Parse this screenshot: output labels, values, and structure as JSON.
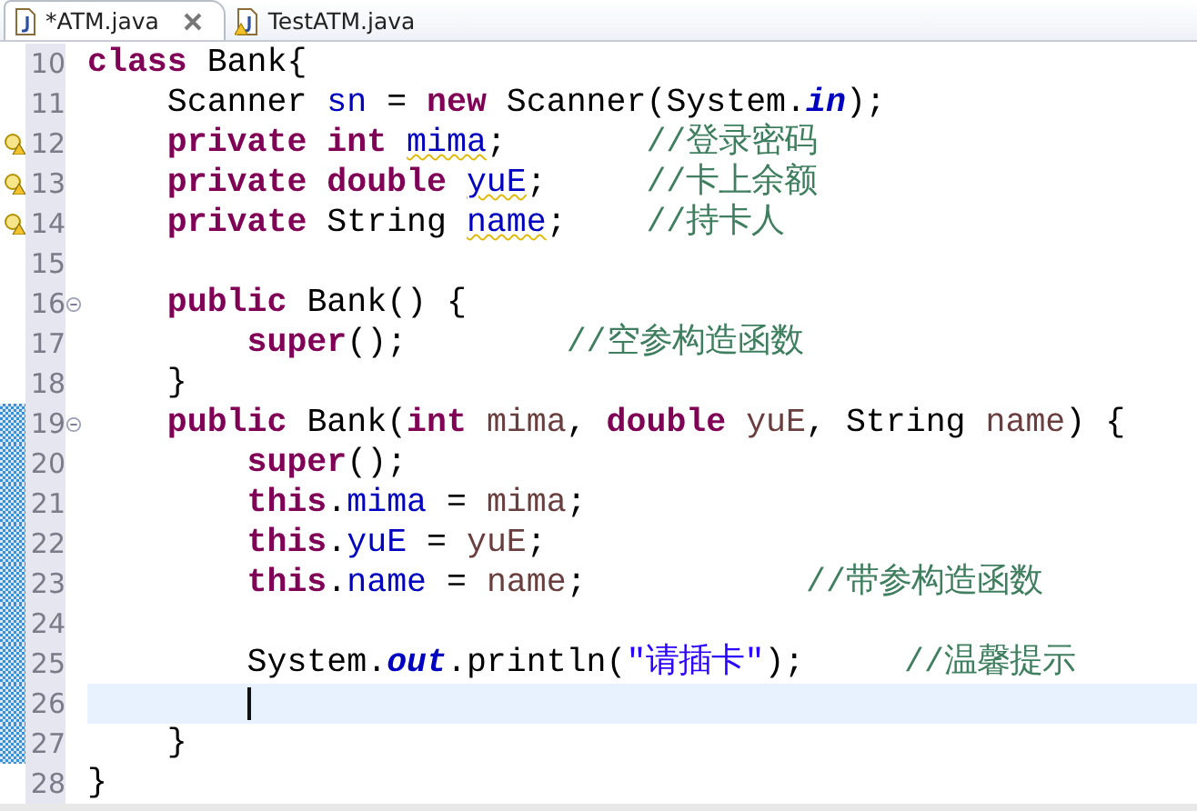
{
  "tabs": [
    {
      "label": "*ATM.java",
      "selected": true,
      "closable": true,
      "warning": false
    },
    {
      "label": "TestATM.java",
      "selected": false,
      "closable": false,
      "warning": true
    }
  ],
  "lines": [
    {
      "number": "10",
      "warning": false,
      "fold": false,
      "changed": false,
      "current": false,
      "tokens": [
        {
          "kind": "kw",
          "text": "class"
        },
        {
          "kind": "plain",
          "text": " Bank{"
        }
      ]
    },
    {
      "number": "11",
      "warning": false,
      "fold": false,
      "changed": false,
      "current": false,
      "tokens": [
        {
          "kind": "plain",
          "text": "    Scanner "
        },
        {
          "kind": "field",
          "text": "sn"
        },
        {
          "kind": "plain",
          "text": " = "
        },
        {
          "kind": "kw",
          "text": "new"
        },
        {
          "kind": "plain",
          "text": " Scanner(System."
        },
        {
          "kind": "static",
          "text": "in"
        },
        {
          "kind": "plain",
          "text": ");"
        }
      ]
    },
    {
      "number": "12",
      "warning": true,
      "fold": false,
      "changed": false,
      "current": false,
      "tokens": [
        {
          "kind": "kw",
          "text": "    private int "
        },
        {
          "kind": "field_warn",
          "text": "mima"
        },
        {
          "kind": "plain",
          "text": ";       "
        },
        {
          "kind": "comment",
          "text": "//登录密码"
        }
      ]
    },
    {
      "number": "13",
      "warning": true,
      "fold": false,
      "changed": false,
      "current": false,
      "tokens": [
        {
          "kind": "kw",
          "text": "    private double "
        },
        {
          "kind": "field_warn",
          "text": "yuE"
        },
        {
          "kind": "plain",
          "text": ";     "
        },
        {
          "kind": "comment",
          "text": "//卡上余额"
        }
      ]
    },
    {
      "number": "14",
      "warning": true,
      "fold": false,
      "changed": false,
      "current": false,
      "tokens": [
        {
          "kind": "kw",
          "text": "    private"
        },
        {
          "kind": "plain",
          "text": " String "
        },
        {
          "kind": "field_warn",
          "text": "name"
        },
        {
          "kind": "plain",
          "text": ";    "
        },
        {
          "kind": "comment",
          "text": "//持卡人"
        }
      ]
    },
    {
      "number": "15",
      "warning": false,
      "fold": false,
      "changed": false,
      "current": false
    },
    {
      "number": "16",
      "warning": false,
      "fold": true,
      "changed": false,
      "current": false,
      "tokens": [
        {
          "kind": "kw",
          "text": "    public"
        },
        {
          "kind": "plain",
          "text": " Bank() {"
        }
      ]
    },
    {
      "number": "17",
      "warning": false,
      "fold": false,
      "changed": false,
      "current": false,
      "tokens": [
        {
          "kind": "kw",
          "text": "        super"
        },
        {
          "kind": "plain",
          "text": "();        "
        },
        {
          "kind": "comment",
          "text": "//空参构造函数"
        }
      ]
    },
    {
      "number": "18",
      "warning": false,
      "fold": false,
      "changed": false,
      "current": false,
      "tokens": [
        {
          "kind": "plain",
          "text": "    }"
        }
      ]
    },
    {
      "number": "19",
      "warning": false,
      "fold": true,
      "changed": true,
      "current": false,
      "tokens": [
        {
          "kind": "kw",
          "text": "    public"
        },
        {
          "kind": "plain",
          "text": " Bank("
        },
        {
          "kind": "kw",
          "text": "int "
        },
        {
          "kind": "local",
          "text": "mima"
        },
        {
          "kind": "plain",
          "text": ", "
        },
        {
          "kind": "kw",
          "text": "double "
        },
        {
          "kind": "local",
          "text": "yuE"
        },
        {
          "kind": "plain",
          "text": ", String "
        },
        {
          "kind": "local",
          "text": "name"
        },
        {
          "kind": "plain",
          "text": ") {"
        }
      ]
    },
    {
      "number": "20",
      "warning": false,
      "fold": false,
      "changed": true,
      "current": false,
      "tokens": [
        {
          "kind": "kw",
          "text": "        super"
        },
        {
          "kind": "plain",
          "text": "();"
        }
      ]
    },
    {
      "number": "21",
      "warning": false,
      "fold": false,
      "changed": true,
      "current": false,
      "tokens": [
        {
          "kind": "kw",
          "text": "        this"
        },
        {
          "kind": "plain",
          "text": "."
        },
        {
          "kind": "field",
          "text": "mima"
        },
        {
          "kind": "plain",
          "text": " = "
        },
        {
          "kind": "local",
          "text": "mima"
        },
        {
          "kind": "plain",
          "text": ";"
        }
      ]
    },
    {
      "number": "22",
      "warning": false,
      "fold": false,
      "changed": true,
      "current": false,
      "tokens": [
        {
          "kind": "kw",
          "text": "        this"
        },
        {
          "kind": "plain",
          "text": "."
        },
        {
          "kind": "field",
          "text": "yuE"
        },
        {
          "kind": "plain",
          "text": " = "
        },
        {
          "kind": "local",
          "text": "yuE"
        },
        {
          "kind": "plain",
          "text": ";"
        }
      ]
    },
    {
      "number": "23",
      "warning": false,
      "fold": false,
      "changed": true,
      "current": false,
      "tokens": [
        {
          "kind": "kw",
          "text": "        this"
        },
        {
          "kind": "plain",
          "text": "."
        },
        {
          "kind": "field",
          "text": "name"
        },
        {
          "kind": "plain",
          "text": " = "
        },
        {
          "kind": "local",
          "text": "name"
        },
        {
          "kind": "plain",
          "text": ";           "
        },
        {
          "kind": "comment",
          "text": "//带参构造函数"
        }
      ]
    },
    {
      "number": "24",
      "warning": false,
      "fold": false,
      "changed": true,
      "current": false
    },
    {
      "number": "25",
      "warning": false,
      "fold": false,
      "changed": true,
      "current": false,
      "tokens": [
        {
          "kind": "plain",
          "text": "        System."
        },
        {
          "kind": "static",
          "text": "out"
        },
        {
          "kind": "plain",
          "text": ".println("
        },
        {
          "kind": "string",
          "text": "\"请插卡\""
        },
        {
          "kind": "plain",
          "text": ");     "
        },
        {
          "kind": "comment",
          "text": "//温馨提示"
        }
      ]
    },
    {
      "number": "26",
      "warning": false,
      "fold": false,
      "changed": true,
      "current": true
    },
    {
      "number": "27",
      "warning": false,
      "fold": false,
      "changed": true,
      "current": false,
      "tokens": [
        {
          "kind": "plain",
          "text": "    }"
        }
      ]
    },
    {
      "number": "28",
      "warning": false,
      "fold": false,
      "changed": false,
      "current": false,
      "tokens": [
        {
          "kind": "plain",
          "text": "}"
        }
      ]
    }
  ]
}
